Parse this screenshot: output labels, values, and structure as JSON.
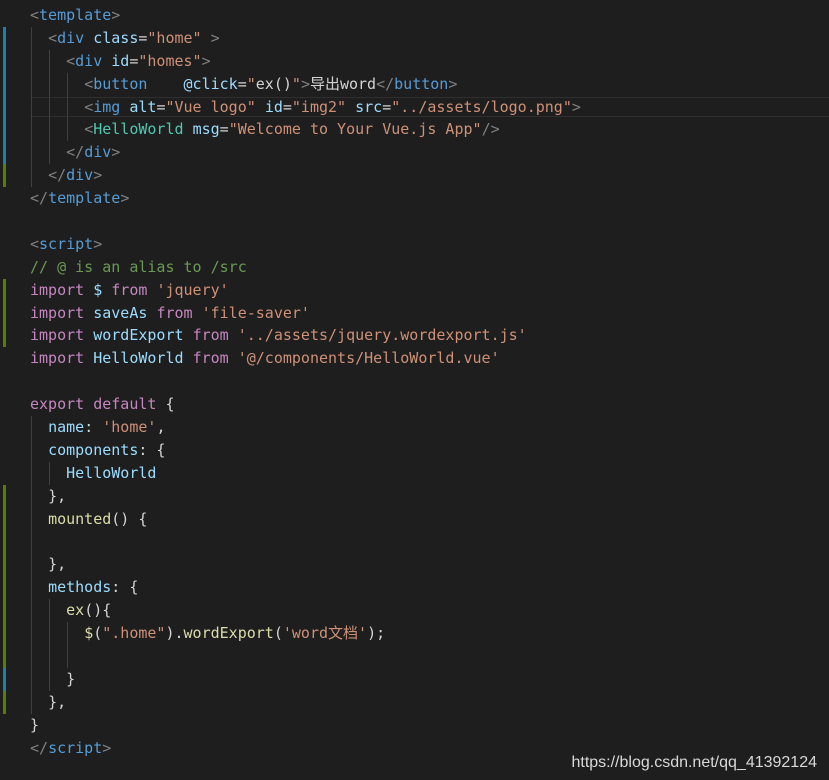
{
  "editor": {
    "background": "#1e1e1e",
    "lines": [
      {
        "indent": 0,
        "tokens": [
          [
            "tag-bracket",
            "<"
          ],
          [
            "tag",
            "template"
          ],
          [
            "tag-bracket",
            ">"
          ]
        ]
      },
      {
        "indent": 1,
        "tokens": [
          [
            "tag-bracket",
            "<"
          ],
          [
            "tag",
            "div"
          ],
          [
            "plain",
            " "
          ],
          [
            "attr",
            "class"
          ],
          [
            "plain",
            "="
          ],
          [
            "str",
            "\"home\""
          ],
          [
            "plain",
            " "
          ],
          [
            "tag-bracket",
            ">"
          ]
        ]
      },
      {
        "indent": 2,
        "tokens": [
          [
            "tag-bracket",
            "<"
          ],
          [
            "tag",
            "div"
          ],
          [
            "plain",
            " "
          ],
          [
            "attr",
            "id"
          ],
          [
            "plain",
            "="
          ],
          [
            "str",
            "\"homes\""
          ],
          [
            "tag-bracket",
            ">"
          ]
        ]
      },
      {
        "indent": 3,
        "tokens": [
          [
            "tag-bracket",
            "<"
          ],
          [
            "tag",
            "button"
          ],
          [
            "plain",
            "    "
          ],
          [
            "attr",
            "@click"
          ],
          [
            "plain",
            "="
          ],
          [
            "str",
            "\""
          ],
          [
            "plain",
            "ex()"
          ],
          [
            "str",
            "\""
          ],
          [
            "tag-bracket",
            ">"
          ],
          [
            "plain",
            "导出word"
          ],
          [
            "tag-bracket",
            "</"
          ],
          [
            "tag",
            "button"
          ],
          [
            "tag-bracket",
            ">"
          ]
        ]
      },
      {
        "indent": 3,
        "active": true,
        "tokens": [
          [
            "tag-bracket",
            "<"
          ],
          [
            "tag",
            "img"
          ],
          [
            "plain",
            " "
          ],
          [
            "attr",
            "alt"
          ],
          [
            "plain",
            "="
          ],
          [
            "str",
            "\"Vue logo\""
          ],
          [
            "plain",
            " "
          ],
          [
            "attr",
            "id"
          ],
          [
            "plain",
            "="
          ],
          [
            "str",
            "\"img2\""
          ],
          [
            "plain",
            " "
          ],
          [
            "attr",
            "src"
          ],
          [
            "plain",
            "="
          ],
          [
            "str",
            "\"../assets/logo.png\""
          ],
          [
            "tag-bracket",
            ">"
          ]
        ]
      },
      {
        "indent": 3,
        "tokens": [
          [
            "tag-bracket",
            "<"
          ],
          [
            "comp",
            "HelloWorld"
          ],
          [
            "plain",
            " "
          ],
          [
            "attr",
            "msg"
          ],
          [
            "plain",
            "="
          ],
          [
            "str",
            "\"Welcome to Your Vue.js App\""
          ],
          [
            "tag-bracket",
            "/>"
          ]
        ]
      },
      {
        "indent": 2,
        "tokens": [
          [
            "tag-bracket",
            "</"
          ],
          [
            "tag",
            "div"
          ],
          [
            "tag-bracket",
            ">"
          ]
        ]
      },
      {
        "indent": 1,
        "tokens": [
          [
            "tag-bracket",
            "</"
          ],
          [
            "tag",
            "div"
          ],
          [
            "tag-bracket",
            ">"
          ]
        ]
      },
      {
        "indent": 0,
        "tokens": [
          [
            "tag-bracket",
            "</"
          ],
          [
            "tag",
            "template"
          ],
          [
            "tag-bracket",
            ">"
          ]
        ]
      },
      {
        "indent": 0,
        "tokens": []
      },
      {
        "indent": 0,
        "tokens": [
          [
            "tag-bracket",
            "<"
          ],
          [
            "tag",
            "script"
          ],
          [
            "tag-bracket",
            ">"
          ]
        ]
      },
      {
        "indent": 0,
        "tokens": [
          [
            "comment",
            "// @ is an alias to /src"
          ]
        ]
      },
      {
        "indent": 0,
        "tokens": [
          [
            "kw",
            "import"
          ],
          [
            "plain",
            " "
          ],
          [
            "var",
            "$"
          ],
          [
            "plain",
            " "
          ],
          [
            "kw",
            "from"
          ],
          [
            "plain",
            " "
          ],
          [
            "str",
            "'jquery'"
          ]
        ]
      },
      {
        "indent": 0,
        "tokens": [
          [
            "kw",
            "import"
          ],
          [
            "plain",
            " "
          ],
          [
            "var",
            "saveAs"
          ],
          [
            "plain",
            " "
          ],
          [
            "kw",
            "from"
          ],
          [
            "plain",
            " "
          ],
          [
            "str",
            "'file-saver'"
          ]
        ]
      },
      {
        "indent": 0,
        "tokens": [
          [
            "kw",
            "import"
          ],
          [
            "plain",
            " "
          ],
          [
            "var",
            "wordExport"
          ],
          [
            "plain",
            " "
          ],
          [
            "kw",
            "from"
          ],
          [
            "plain",
            " "
          ],
          [
            "str",
            "'../assets/jquery.wordexport.js'"
          ]
        ]
      },
      {
        "indent": 0,
        "tokens": [
          [
            "kw",
            "import"
          ],
          [
            "plain",
            " "
          ],
          [
            "var",
            "HelloWorld"
          ],
          [
            "plain",
            " "
          ],
          [
            "kw",
            "from"
          ],
          [
            "plain",
            " "
          ],
          [
            "str",
            "'@/components/HelloWorld.vue'"
          ]
        ]
      },
      {
        "indent": 0,
        "tokens": []
      },
      {
        "indent": 0,
        "tokens": [
          [
            "kw",
            "export"
          ],
          [
            "plain",
            " "
          ],
          [
            "kw",
            "default"
          ],
          [
            "plain",
            " {"
          ]
        ]
      },
      {
        "indent": 1,
        "tokens": [
          [
            "var",
            "name"
          ],
          [
            "plain",
            ": "
          ],
          [
            "str",
            "'home'"
          ],
          [
            "plain",
            ","
          ]
        ]
      },
      {
        "indent": 1,
        "tokens": [
          [
            "var",
            "components"
          ],
          [
            "plain",
            ": {"
          ]
        ]
      },
      {
        "indent": 2,
        "tokens": [
          [
            "var",
            "HelloWorld"
          ]
        ]
      },
      {
        "indent": 1,
        "tokens": [
          [
            "plain",
            "},"
          ]
        ]
      },
      {
        "indent": 1,
        "tokens": [
          [
            "fn",
            "mounted"
          ],
          [
            "plain",
            "() {"
          ]
        ]
      },
      {
        "indent": 1,
        "tokens": []
      },
      {
        "indent": 1,
        "tokens": [
          [
            "plain",
            "},"
          ]
        ]
      },
      {
        "indent": 1,
        "tokens": [
          [
            "var",
            "methods"
          ],
          [
            "plain",
            ": {"
          ]
        ]
      },
      {
        "indent": 2,
        "tokens": [
          [
            "fn",
            "ex"
          ],
          [
            "plain",
            "(){"
          ]
        ]
      },
      {
        "indent": 3,
        "tokens": [
          [
            "fn",
            "$"
          ],
          [
            "plain",
            "("
          ],
          [
            "str",
            "\".home\""
          ],
          [
            "plain",
            ")."
          ],
          [
            "fn",
            "wordExport"
          ],
          [
            "plain",
            "("
          ],
          [
            "str",
            "'word文档'"
          ],
          [
            "plain",
            ");"
          ]
        ]
      },
      {
        "indent": 3,
        "tokens": []
      },
      {
        "indent": 2,
        "tokens": [
          [
            "plain",
            "}"
          ]
        ]
      },
      {
        "indent": 1,
        "tokens": [
          [
            "plain",
            "},"
          ]
        ]
      },
      {
        "indent": 0,
        "tokens": [
          [
            "plain",
            "}"
          ]
        ]
      },
      {
        "indent": 0,
        "tokens": [
          [
            "tag-bracket",
            "</"
          ],
          [
            "tag",
            "script"
          ],
          [
            "tag-bracket",
            ">"
          ]
        ]
      }
    ],
    "gutter_marks": [
      {
        "color": "blue",
        "from_line": 1,
        "to_line": 6
      },
      {
        "color": "green",
        "from_line": 7,
        "to_line": 7
      },
      {
        "color": "green",
        "from_line": 12,
        "to_line": 14
      },
      {
        "color": "green",
        "from_line": 21,
        "to_line": 28
      },
      {
        "color": "blue",
        "from_line": 29,
        "to_line": 29
      },
      {
        "color": "green",
        "from_line": 30,
        "to_line": 30
      }
    ],
    "guides": [
      {
        "level": 1,
        "from_line": 1,
        "to_line": 7
      },
      {
        "level": 2,
        "from_line": 2,
        "to_line": 6
      },
      {
        "level": 3,
        "from_line": 3,
        "to_line": 5
      },
      {
        "level": 1,
        "from_line": 18,
        "to_line": 30
      },
      {
        "level": 2,
        "from_line": 20,
        "to_line": 20
      },
      {
        "level": 2,
        "from_line": 26,
        "to_line": 29
      },
      {
        "level": 3,
        "from_line": 27,
        "to_line": 28
      }
    ]
  },
  "watermark": {
    "text": "https://blog.csdn.net/qq_41392124"
  }
}
